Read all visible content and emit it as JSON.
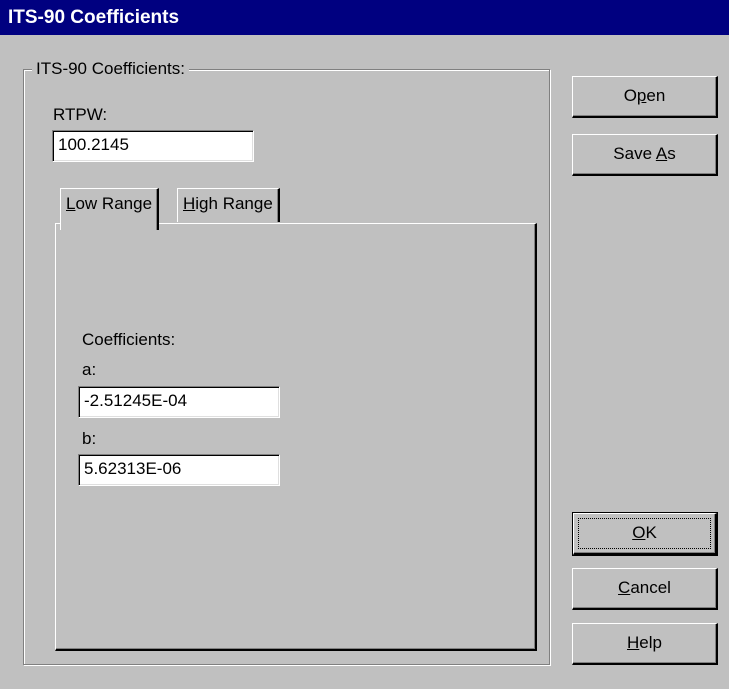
{
  "window": {
    "title": "ITS-90 Coefficients"
  },
  "group": {
    "title": "ITS-90 Coefficients:"
  },
  "rtpw": {
    "label": "RTPW:",
    "value": "100.2145"
  },
  "tabs": [
    {
      "pre": "",
      "mnemonic": "L",
      "post": "ow Range",
      "selected": true
    },
    {
      "pre": "",
      "mnemonic": "H",
      "post": "igh Range",
      "selected": false
    }
  ],
  "coefficients": {
    "heading": "Coefficients:",
    "a_label": "a:",
    "a_value": "-2.51245E-04",
    "b_label": "b:",
    "b_value": "5.62313E-06"
  },
  "buttons": {
    "open": {
      "pre": "O",
      "mnemonic": "p",
      "post": "en"
    },
    "saveas": {
      "pre": "Save ",
      "mnemonic": "A",
      "post": "s"
    },
    "ok": {
      "pre": "",
      "mnemonic": "O",
      "post": "K"
    },
    "cancel": {
      "pre": "",
      "mnemonic": "C",
      "post": "ancel"
    },
    "help": {
      "pre": "",
      "mnemonic": "H",
      "post": "elp"
    }
  },
  "colors": {
    "titlebar": "#000080",
    "face": "#c0c0c0"
  }
}
